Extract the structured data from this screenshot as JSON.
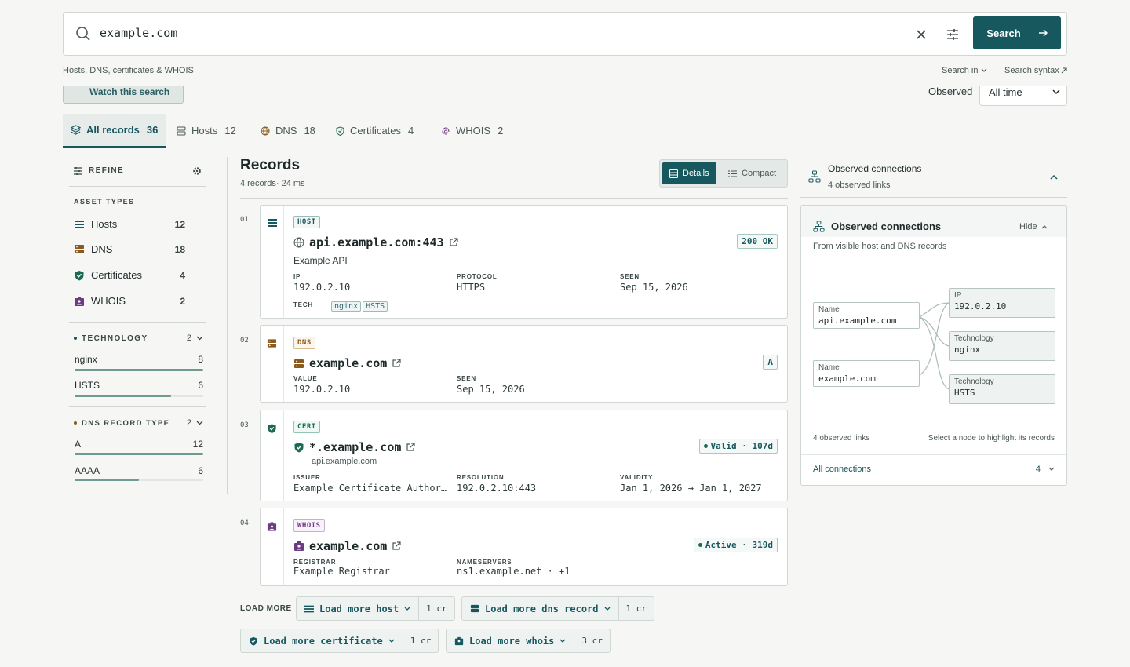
{
  "search": {
    "query": "example.com",
    "button_label": "Search",
    "hint": "Hosts, DNS, certificates & WHOIS",
    "search_in": "Search in",
    "syntax": "Search syntax"
  },
  "watch": {
    "label": "Watch this search"
  },
  "observed": {
    "label": "Observed",
    "value": "All time"
  },
  "tabs": [
    {
      "label": "All records",
      "count": "36"
    },
    {
      "label": "Hosts",
      "count": "12"
    },
    {
      "label": "DNS",
      "count": "18"
    },
    {
      "label": "Certificates",
      "count": "4"
    },
    {
      "label": "WHOIS",
      "count": "2"
    }
  ],
  "sidebar": {
    "refine": "REFINE",
    "asset_types_title": "ASSET TYPES",
    "asset_types": [
      {
        "label": "Hosts",
        "count": "12"
      },
      {
        "label": "DNS",
        "count": "18"
      },
      {
        "label": "Certificates",
        "count": "4"
      },
      {
        "label": "WHOIS",
        "count": "2"
      }
    ],
    "technology": {
      "title": "TECHNOLOGY",
      "count": "2",
      "items": [
        {
          "label": "nginx",
          "count": "8",
          "fraction": 1.0
        },
        {
          "label": "HSTS",
          "count": "6",
          "fraction": 0.75
        }
      ]
    },
    "dns_type": {
      "title": "DNS RECORD TYPE",
      "count": "2",
      "items": [
        {
          "label": "A",
          "count": "12",
          "fraction": 1.0
        },
        {
          "label": "AAAA",
          "count": "6",
          "fraction": 0.5
        }
      ]
    }
  },
  "records": {
    "title": "Records",
    "subtitle": "4 records· 24 ms",
    "view_details": "Details",
    "view_compact": "Compact",
    "items": [
      {
        "num": "01",
        "badge": "HOST",
        "title": "api.example.com:443",
        "status": "200 OK",
        "description": "Example API",
        "fields": [
          {
            "k": "IP",
            "v": "192.0.2.10"
          },
          {
            "k": "PROTOCOL",
            "v": "HTTPS"
          },
          {
            "k": "SEEN",
            "v": "Sep 15, 2026"
          }
        ],
        "tech_label": "TECH",
        "tech": [
          "nginx",
          "HSTS"
        ]
      },
      {
        "num": "02",
        "badge": "DNS",
        "title": "example.com",
        "status": "A",
        "fields": [
          {
            "k": "VALUE",
            "v": "192.0.2.10"
          },
          {
            "k": "SEEN",
            "v": "Sep 15, 2026"
          }
        ]
      },
      {
        "num": "03",
        "badge": "CERT",
        "title": "*.example.com",
        "status": "Valid · 107d",
        "subtitle": "api.example.com",
        "fields": [
          {
            "k": "ISSUER",
            "v": "Example Certificate Authority"
          },
          {
            "k": "RESOLUTION",
            "v": "192.0.2.10:443"
          },
          {
            "k": "VALIDITY",
            "v": "Jan 1, 2026 → Jan 1, 2027"
          }
        ]
      },
      {
        "num": "04",
        "badge": "WHOIS",
        "title": "example.com",
        "status": "Active · 319d",
        "fields": [
          {
            "k": "REGISTRAR",
            "v": "Example Registrar"
          },
          {
            "k": "NAMESERVERS",
            "v": "ns1.example.net · +1"
          }
        ]
      }
    ]
  },
  "load_more": {
    "label": "LOAD MORE",
    "buttons": [
      {
        "label": "Load more host",
        "cost": "1 cr"
      },
      {
        "label": "Load more dns record",
        "cost": "1 cr"
      },
      {
        "label": "Load more certificate",
        "cost": "1 cr"
      },
      {
        "label": "Load more whois",
        "cost": "3 cr"
      }
    ]
  },
  "connections": {
    "header_title": "Observed connections",
    "header_sub": "4 observed links",
    "card_title": "Observed connections",
    "hide": "Hide",
    "card_sub": "From visible host and DNS records",
    "left_nodes": [
      {
        "k": "Name",
        "v": "api.example.com"
      },
      {
        "k": "Name",
        "v": "example.com"
      }
    ],
    "right_nodes": [
      {
        "k": "IP",
        "v": "192.0.2.10"
      },
      {
        "k": "Technology",
        "v": "nginx"
      },
      {
        "k": "Technology",
        "v": "HSTS"
      }
    ],
    "footer_left": "4 observed links",
    "footer_right": "Select a node to highlight its records",
    "all_label": "All connections",
    "all_count": "4"
  },
  "colors": {
    "accent": "#17575e",
    "dns": "#8a5a1c",
    "cert": "#1a6a55",
    "whois": "#6b3b83"
  }
}
